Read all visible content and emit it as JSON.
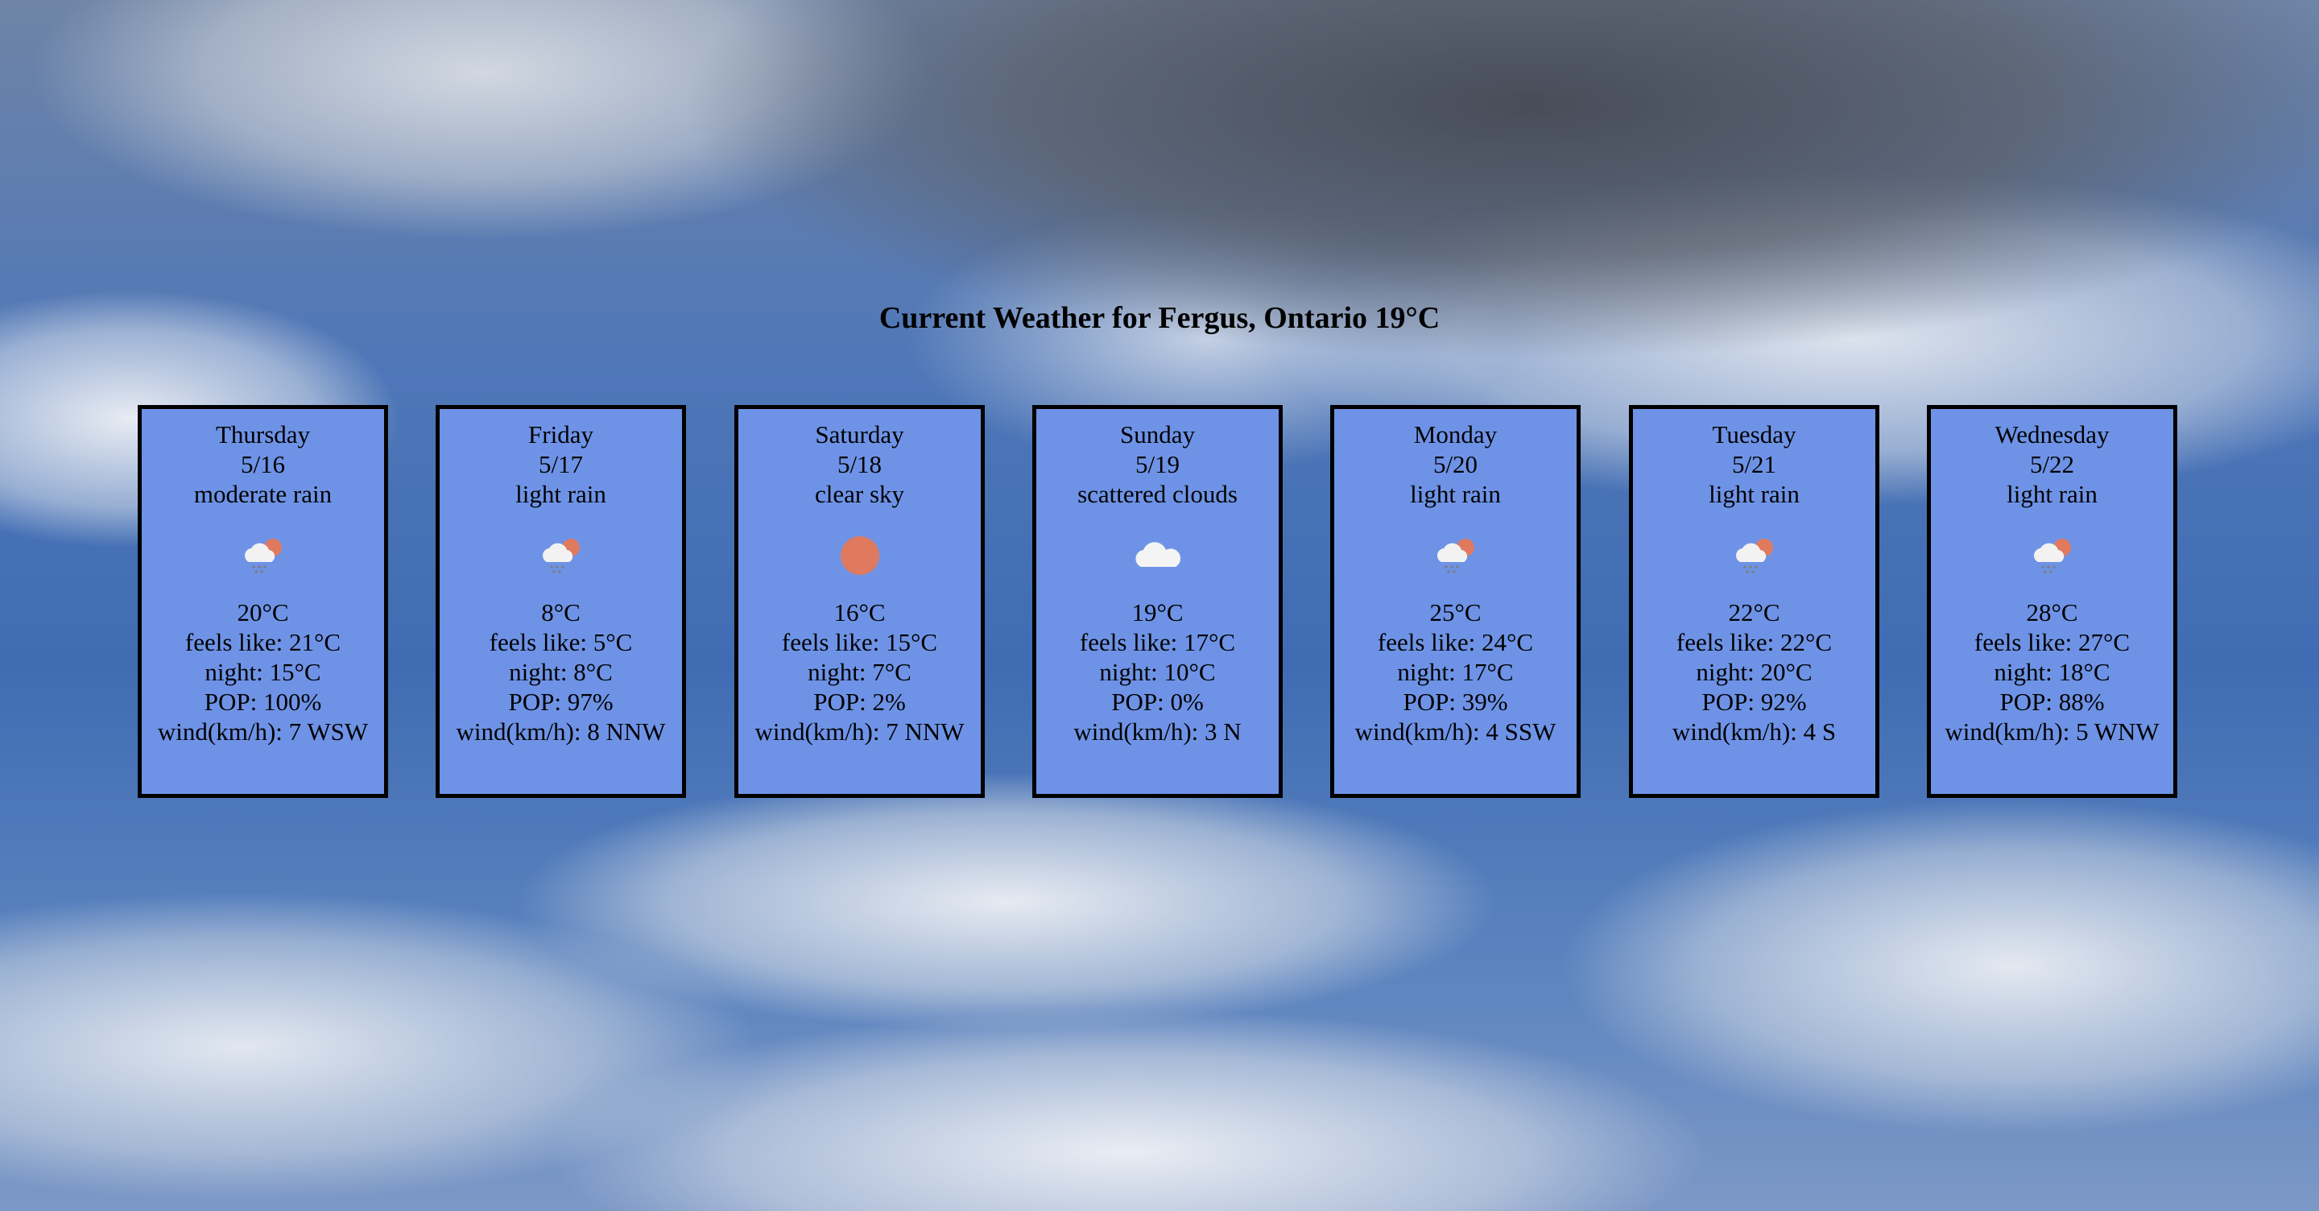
{
  "header": {
    "title": "Current Weather for Fergus, Ontario 19°C"
  },
  "colors": {
    "card_bg": "#6e93e6",
    "card_border": "#000000",
    "sun": "#e07a5f"
  },
  "days": [
    {
      "day": "Thursday",
      "date": "5/16",
      "desc": "moderate rain",
      "icon": "rain-cloud-sun-icon",
      "temp": "20°C",
      "feels": "feels like: 21°C",
      "night": "night: 15°C",
      "pop": "POP: 100%",
      "wind": "wind(km/h): 7 WSW"
    },
    {
      "day": "Friday",
      "date": "5/17",
      "desc": "light rain",
      "icon": "rain-cloud-sun-icon",
      "temp": "8°C",
      "feels": "feels like: 5°C",
      "night": "night: 8°C",
      "pop": "POP: 97%",
      "wind": "wind(km/h): 8 NNW"
    },
    {
      "day": "Saturday",
      "date": "5/18",
      "desc": "clear sky",
      "icon": "sun-icon",
      "temp": "16°C",
      "feels": "feels like: 15°C",
      "night": "night: 7°C",
      "pop": "POP: 2%",
      "wind": "wind(km/h): 7 NNW"
    },
    {
      "day": "Sunday",
      "date": "5/19",
      "desc": "scattered clouds",
      "icon": "cloud-icon",
      "temp": "19°C",
      "feels": "feels like: 17°C",
      "night": "night: 10°C",
      "pop": "POP: 0%",
      "wind": "wind(km/h): 3 N"
    },
    {
      "day": "Monday",
      "date": "5/20",
      "desc": "light rain",
      "icon": "rain-cloud-sun-icon",
      "temp": "25°C",
      "feels": "feels like: 24°C",
      "night": "night: 17°C",
      "pop": "POP: 39%",
      "wind": "wind(km/h): 4 SSW"
    },
    {
      "day": "Tuesday",
      "date": "5/21",
      "desc": "light rain",
      "icon": "rain-cloud-sun-icon",
      "temp": "22°C",
      "feels": "feels like: 22°C",
      "night": "night: 20°C",
      "pop": "POP: 92%",
      "wind": "wind(km/h): 4 S"
    },
    {
      "day": "Wednesday",
      "date": "5/22",
      "desc": "light rain",
      "icon": "rain-cloud-sun-icon",
      "temp": "28°C",
      "feels": "feels like: 27°C",
      "night": "night: 18°C",
      "pop": "POP: 88%",
      "wind": "wind(km/h): 5 WNW"
    }
  ]
}
